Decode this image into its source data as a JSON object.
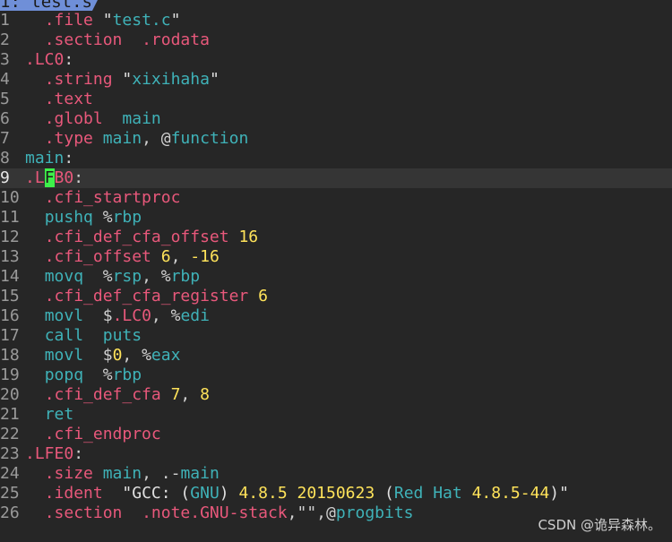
{
  "tab": {
    "label": "1: test.s"
  },
  "colors": {
    "background": "#262626",
    "directive": "#e8587b",
    "keyword": "#3fb2b8",
    "number": "#ffe35a",
    "cursor": "#3ef04a",
    "tab": "#6f8fd8"
  },
  "editor": {
    "current_line": 9,
    "lines": [
      {
        "n": "1",
        "tokens": [
          [
            "  ",
            "def"
          ],
          [
            ".file",
            "dir"
          ],
          [
            " \"",
            "str"
          ],
          [
            "test.c",
            "kw"
          ],
          [
            "\"",
            "str"
          ]
        ]
      },
      {
        "n": "2",
        "tokens": [
          [
            "  ",
            "def"
          ],
          [
            ".section",
            "dir"
          ],
          [
            "  ",
            "def"
          ],
          [
            ".rodata",
            "dir"
          ]
        ]
      },
      {
        "n": "3",
        "tokens": [
          [
            ".LC0",
            "lbl"
          ],
          [
            ":",
            "def"
          ]
        ]
      },
      {
        "n": "4",
        "tokens": [
          [
            "  ",
            "def"
          ],
          [
            ".string",
            "dir"
          ],
          [
            " \"",
            "str"
          ],
          [
            "xixihaha",
            "kw"
          ],
          [
            "\"",
            "str"
          ]
        ]
      },
      {
        "n": "5",
        "tokens": [
          [
            "  ",
            "def"
          ],
          [
            ".text",
            "dir"
          ]
        ]
      },
      {
        "n": "6",
        "tokens": [
          [
            "  ",
            "def"
          ],
          [
            ".globl",
            "dir"
          ],
          [
            "  ",
            "def"
          ],
          [
            "main",
            "kw"
          ]
        ]
      },
      {
        "n": "7",
        "tokens": [
          [
            "  ",
            "def"
          ],
          [
            ".type",
            "dir"
          ],
          [
            " ",
            "def"
          ],
          [
            "main",
            "kw"
          ],
          [
            ", @",
            "def"
          ],
          [
            "function",
            "kw"
          ]
        ]
      },
      {
        "n": "8",
        "tokens": [
          [
            "main",
            "kw"
          ],
          [
            ":",
            "def"
          ]
        ]
      },
      {
        "n": "9",
        "tokens": [
          [
            ".L",
            "lbl"
          ],
          [
            "F",
            "cursor"
          ],
          [
            "B0",
            "lbl"
          ],
          [
            ":",
            "def"
          ]
        ]
      },
      {
        "n": "10",
        "tokens": [
          [
            "  ",
            "def"
          ],
          [
            ".cfi_startproc",
            "dir"
          ]
        ]
      },
      {
        "n": "11",
        "tokens": [
          [
            "  ",
            "def"
          ],
          [
            "pushq",
            "kw"
          ],
          [
            " %",
            "def"
          ],
          [
            "rbp",
            "kw"
          ]
        ]
      },
      {
        "n": "12",
        "tokens": [
          [
            "  ",
            "def"
          ],
          [
            ".cfi_def_cfa_offset",
            "dir"
          ],
          [
            " ",
            "def"
          ],
          [
            "16",
            "num"
          ]
        ]
      },
      {
        "n": "13",
        "tokens": [
          [
            "  ",
            "def"
          ],
          [
            ".cfi_offset",
            "dir"
          ],
          [
            " ",
            "def"
          ],
          [
            "6",
            "num"
          ],
          [
            ", ",
            "def"
          ],
          [
            "-16",
            "num"
          ]
        ]
      },
      {
        "n": "14",
        "tokens": [
          [
            "  ",
            "def"
          ],
          [
            "movq",
            "kw"
          ],
          [
            "  %",
            "def"
          ],
          [
            "rsp",
            "kw"
          ],
          [
            ", %",
            "def"
          ],
          [
            "rbp",
            "kw"
          ]
        ]
      },
      {
        "n": "15",
        "tokens": [
          [
            "  ",
            "def"
          ],
          [
            ".cfi_def_cfa_register",
            "dir"
          ],
          [
            " ",
            "def"
          ],
          [
            "6",
            "num"
          ]
        ]
      },
      {
        "n": "16",
        "tokens": [
          [
            "  ",
            "def"
          ],
          [
            "movl",
            "kw"
          ],
          [
            "  $",
            "def"
          ],
          [
            ".LC0",
            "lbl"
          ],
          [
            ", %",
            "def"
          ],
          [
            "edi",
            "kw"
          ]
        ]
      },
      {
        "n": "17",
        "tokens": [
          [
            "  ",
            "def"
          ],
          [
            "call",
            "kw"
          ],
          [
            "  ",
            "def"
          ],
          [
            "puts",
            "kw"
          ]
        ]
      },
      {
        "n": "18",
        "tokens": [
          [
            "  ",
            "def"
          ],
          [
            "movl",
            "kw"
          ],
          [
            "  $",
            "def"
          ],
          [
            "0",
            "num"
          ],
          [
            ", %",
            "def"
          ],
          [
            "eax",
            "kw"
          ]
        ]
      },
      {
        "n": "19",
        "tokens": [
          [
            "  ",
            "def"
          ],
          [
            "popq",
            "kw"
          ],
          [
            "  %",
            "def"
          ],
          [
            "rbp",
            "kw"
          ]
        ]
      },
      {
        "n": "20",
        "tokens": [
          [
            "  ",
            "def"
          ],
          [
            ".cfi_def_cfa",
            "dir"
          ],
          [
            " ",
            "def"
          ],
          [
            "7",
            "num"
          ],
          [
            ", ",
            "def"
          ],
          [
            "8",
            "num"
          ]
        ]
      },
      {
        "n": "21",
        "tokens": [
          [
            "  ",
            "def"
          ],
          [
            "ret",
            "kw"
          ]
        ]
      },
      {
        "n": "22",
        "tokens": [
          [
            "  ",
            "def"
          ],
          [
            ".cfi_endproc",
            "dir"
          ]
        ]
      },
      {
        "n": "23",
        "tokens": [
          [
            ".LFE0",
            "lbl"
          ],
          [
            ":",
            "def"
          ]
        ]
      },
      {
        "n": "24",
        "tokens": [
          [
            "  ",
            "def"
          ],
          [
            ".size",
            "dir"
          ],
          [
            " ",
            "def"
          ],
          [
            "main",
            "kw"
          ],
          [
            ", .-",
            "def"
          ],
          [
            "main",
            "kw"
          ]
        ]
      },
      {
        "n": "25",
        "tokens": [
          [
            "  ",
            "def"
          ],
          [
            ".ident",
            "dir"
          ],
          [
            "  \"GCC: (",
            "str"
          ],
          [
            "GNU",
            "kw"
          ],
          [
            ") ",
            "str"
          ],
          [
            "4.8.5 20150623",
            "num"
          ],
          [
            " (",
            "str"
          ],
          [
            "Red Hat",
            "kw"
          ],
          [
            " ",
            "str"
          ],
          [
            "4.8.5-44",
            "num"
          ],
          [
            ")\"",
            "str"
          ]
        ]
      },
      {
        "n": "26",
        "tokens": [
          [
            "  ",
            "def"
          ],
          [
            ".section",
            "dir"
          ],
          [
            "  ",
            "def"
          ],
          [
            ".note.GNU-stack",
            "dir"
          ],
          [
            ",\"\",@",
            "def"
          ],
          [
            "progbits",
            "kw"
          ]
        ]
      }
    ]
  },
  "watermark": "CSDN @诡异森林。"
}
